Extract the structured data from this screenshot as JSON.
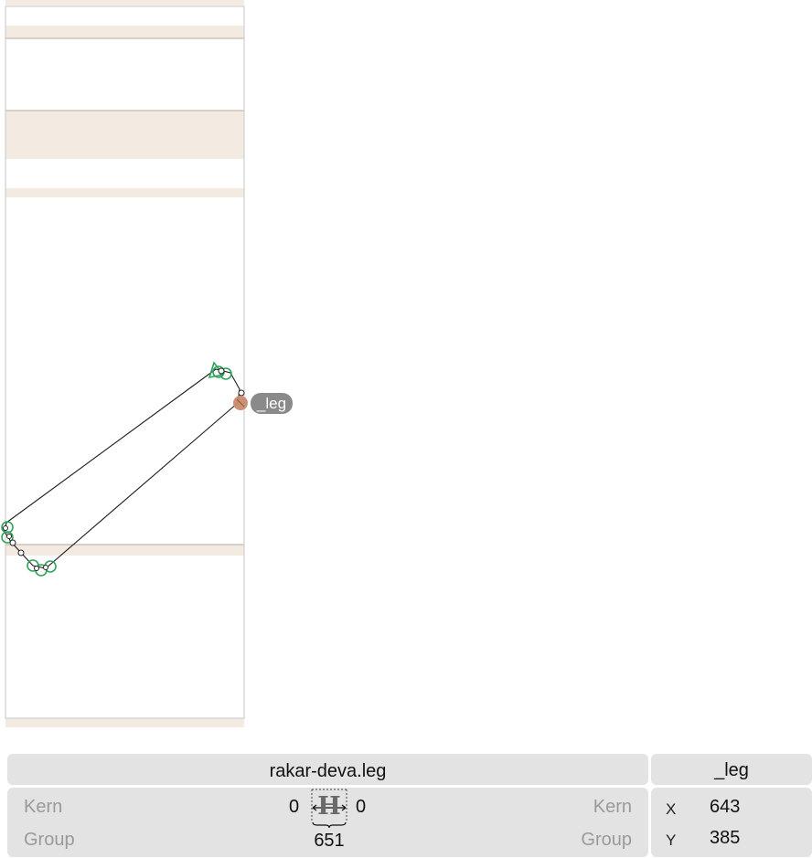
{
  "glyph": {
    "name": "rakar-deva.leg",
    "anchor_label": "_leg"
  },
  "metrics": {
    "left_kern_label": "Kern",
    "left_group_label": "Group",
    "right_kern_label": "Kern",
    "right_group_label": "Group",
    "left_kern_value": "0",
    "right_kern_value": "0",
    "width_value": "651",
    "preview_glyph": "H"
  },
  "anchor_inspector": {
    "name": "_leg",
    "x_label": "X",
    "y_label": "Y",
    "x_value": "643",
    "y_value": "385"
  },
  "colors": {
    "zone_fill": "#f3ebe2",
    "zone_line": "#b9a99a",
    "point_green": "#2fa35a",
    "anchor_fill": "#c98a6a",
    "anchor_badge": "#8a8a8a",
    "panel_bg": "#e3e3e3"
  }
}
